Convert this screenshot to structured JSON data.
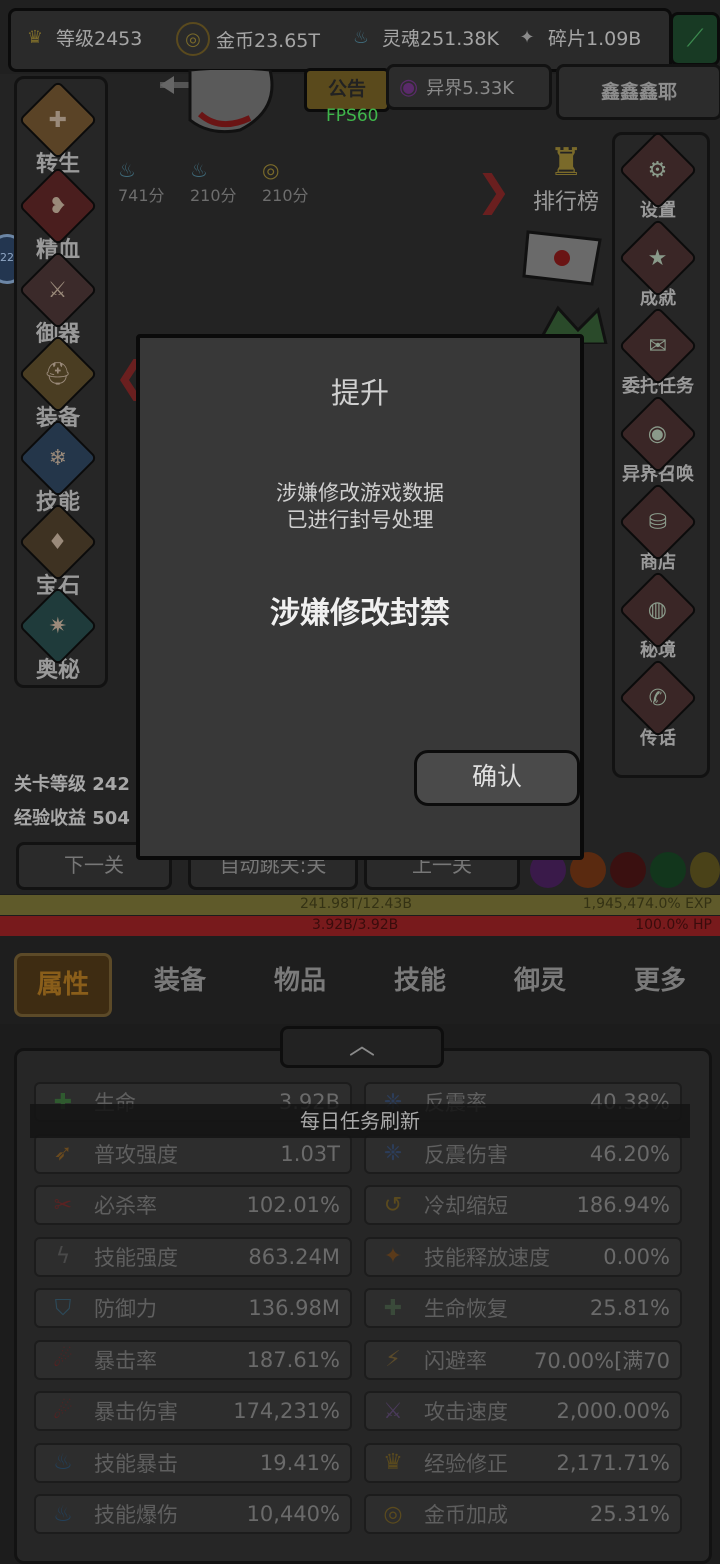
{
  "resources": {
    "level": "等级2453",
    "gold": "金币23.65T",
    "soul": "灵魂251.38K",
    "fragment": "碎片1.09B",
    "otherworld": "异界5.33K"
  },
  "header": {
    "notice": "公告",
    "fps": "FPS60",
    "username": "鑫鑫鑫耶",
    "level_badge": "22"
  },
  "timers": [
    "741分",
    "210分",
    "210分"
  ],
  "left_menu": [
    {
      "label": "转生",
      "icon": "rebirth-icon",
      "glyph": "✚",
      "color": "#5a4326"
    },
    {
      "label": "精血",
      "icon": "blood-icon",
      "glyph": "❥",
      "color": "#4a1e1e"
    },
    {
      "label": "御器",
      "icon": "sword-icon",
      "glyph": "⚔",
      "color": "#3b2a2a"
    },
    {
      "label": "装备",
      "icon": "helmet-icon",
      "glyph": "⛑",
      "color": "#4a3d22"
    },
    {
      "label": "技能",
      "icon": "crystal-icon",
      "glyph": "❄",
      "color": "#24364a"
    },
    {
      "label": "宝石",
      "icon": "gem-bag-icon",
      "glyph": "♦",
      "color": "#3e3222"
    },
    {
      "label": "奥秘",
      "icon": "arcane-icon",
      "glyph": "✷",
      "color": "#1f3b3b"
    }
  ],
  "right_menu": [
    {
      "label": "设置",
      "icon": "gear-icon",
      "glyph": "⚙"
    },
    {
      "label": "成就",
      "icon": "star-icon",
      "glyph": "★"
    },
    {
      "label": "委托任务",
      "icon": "scroll-icon",
      "glyph": "✉"
    },
    {
      "label": "异界召唤",
      "icon": "portal-icon",
      "glyph": "◉"
    },
    {
      "label": "商店",
      "icon": "shop-bag-icon",
      "glyph": "⛁"
    },
    {
      "label": "秘境",
      "icon": "secret-realm-icon",
      "glyph": "◍"
    },
    {
      "label": "传话",
      "icon": "megaphone-icon",
      "glyph": "✆"
    }
  ],
  "rank_label": "排行榜",
  "stage": {
    "level": "关卡等级 242",
    "exp_gain": "经验收益 504"
  },
  "nav": {
    "next": "下一关",
    "auto": "自动跳关:关",
    "prev": "上一关"
  },
  "bars": {
    "exp_text": "241.98T/12.43B",
    "exp_percent": "1,945,474.0% EXP",
    "hp_text": "3.92B/3.92B",
    "hp_percent": "100.0%  HP"
  },
  "tabs": [
    "属性",
    "装备",
    "物品",
    "技能",
    "御灵",
    "更多"
  ],
  "toast": "每日任务刷新",
  "stats_left": [
    {
      "name": "生命",
      "value": "3.92B",
      "icon": "heal-cross-icon",
      "glyph": "✚",
      "color": "#2f5a2f"
    },
    {
      "name": "普攻强度",
      "value": "1.03T",
      "icon": "feather-sword-icon",
      "glyph": "➶",
      "color": "#6a4a1e"
    },
    {
      "name": "必杀率",
      "value": "102.01%",
      "icon": "slash-icon",
      "glyph": "✂",
      "color": "#5a2222"
    },
    {
      "name": "技能强度",
      "value": "863.24M",
      "icon": "lightning-icon",
      "glyph": "ϟ",
      "color": "#4a4a4a"
    },
    {
      "name": "防御力",
      "value": "136.98M",
      "icon": "shield-icon",
      "glyph": "⛉",
      "color": "#2c4a5a"
    },
    {
      "name": "暴击率",
      "value": "187.61%",
      "icon": "claw-icon",
      "glyph": "☄",
      "color": "#5a2020"
    },
    {
      "name": "暴击伤害",
      "value": "174,231%",
      "icon": "claw-red-icon",
      "glyph": "☄",
      "color": "#5a2020"
    },
    {
      "name": "技能暴击",
      "value": "19.41%",
      "icon": "blue-flame-icon",
      "glyph": "♨",
      "color": "#23405a"
    },
    {
      "name": "技能爆伤",
      "value": "10,440%",
      "icon": "blue-flame-2-icon",
      "glyph": "♨",
      "color": "#23405a"
    }
  ],
  "stats_right": [
    {
      "name": "反震率",
      "value": "40.38%",
      "icon": "reflect-icon",
      "glyph": "❈",
      "color": "#2c3d5a"
    },
    {
      "name": "反震伤害",
      "value": "46.20%",
      "icon": "reflect-dmg-icon",
      "glyph": "❈",
      "color": "#2c3d5a"
    },
    {
      "name": "冷却缩短",
      "value": "186.94%",
      "icon": "cooldown-icon",
      "glyph": "↺",
      "color": "#5a4a1e"
    },
    {
      "name": "技能释放速度",
      "value": "0.00%",
      "icon": "cast-speed-icon",
      "glyph": "✦",
      "color": "#5a3a1a"
    },
    {
      "name": "生命恢复",
      "value": "25.81%",
      "icon": "regen-icon",
      "glyph": "✚",
      "color": "#3a4a3a"
    },
    {
      "name": "闪避率",
      "value": "70.00%[满70",
      "icon": "boot-icon",
      "glyph": "⚡",
      "color": "#5a4a2a"
    },
    {
      "name": "攻击速度",
      "value": "2,000.00%",
      "icon": "crossed-swords-icon",
      "glyph": "⚔",
      "color": "#4a3a5a"
    },
    {
      "name": "经验修正",
      "value": "2,171.71%",
      "icon": "crown-icon",
      "glyph": "♛",
      "color": "#5a4a1e"
    },
    {
      "name": "金币加成",
      "value": "25.31%",
      "icon": "coin-icon",
      "glyph": "◎",
      "color": "#5a4a1e"
    }
  ],
  "dialog": {
    "title": "提升",
    "line1": "涉嫌修改游戏数据",
    "line2": "已进行封号处理",
    "ban": "涉嫌修改封禁",
    "confirm": "确认"
  }
}
